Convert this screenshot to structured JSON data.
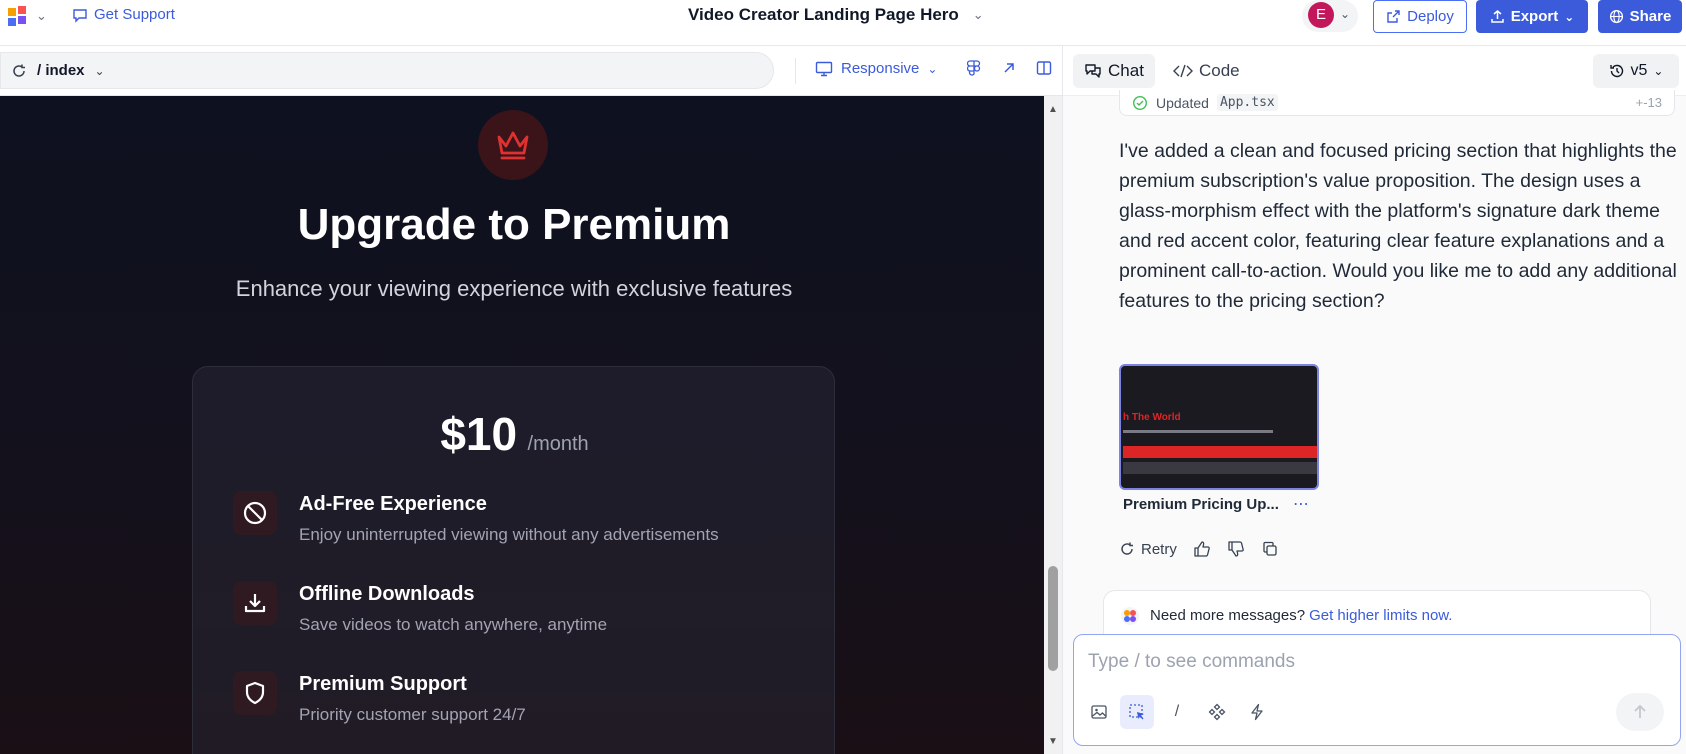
{
  "app": {
    "support_label": "Get Support",
    "project_title": "Video Creator Landing Page Hero",
    "avatar_initial": "E",
    "deploy_label": "Deploy",
    "export_label": "Export",
    "share_label": "Share"
  },
  "preview_toolbar": {
    "path": "/ index",
    "responsive_label": "Responsive"
  },
  "hero": {
    "title": "Upgrade to Premium",
    "subtitle": "Enhance your viewing experience with exclusive features",
    "price": "$10",
    "period": "/month",
    "features": [
      {
        "name": "Ad-Free Experience",
        "desc": "Enjoy uninterrupted viewing without any advertisements",
        "icon": "ban-icon"
      },
      {
        "name": "Offline Downloads",
        "desc": "Save videos to watch anywhere, anytime",
        "icon": "download-icon"
      },
      {
        "name": "Premium Support",
        "desc": "Priority customer support 24/7",
        "icon": "shield-icon"
      }
    ]
  },
  "chat": {
    "tab_chat": "Chat",
    "tab_code": "Code",
    "version": "v5",
    "updated_label": "Updated",
    "updated_file": "App.tsx",
    "updated_diff": "+-13",
    "message": "I've added a clean and focused pricing section that highlights the premium subscription's value proposition. The design uses a glass-morphism effect with the platform's signature dark theme and red accent color, featuring clear feature explanations and a prominent call-to-action. Would you like me to add any additional features to the pricing section?",
    "thumb_label": "Premium Pricing Up...",
    "thumb_title": "h The World",
    "retry_label": "Retry",
    "limits_text": "Need more messages?",
    "limits_link": "Get higher limits now.",
    "composer_placeholder": "Type / to see commands"
  },
  "colors": {
    "accent": "#3b5bdb",
    "brand_red": "#dc2626",
    "preview_bg": "#0e1120"
  }
}
